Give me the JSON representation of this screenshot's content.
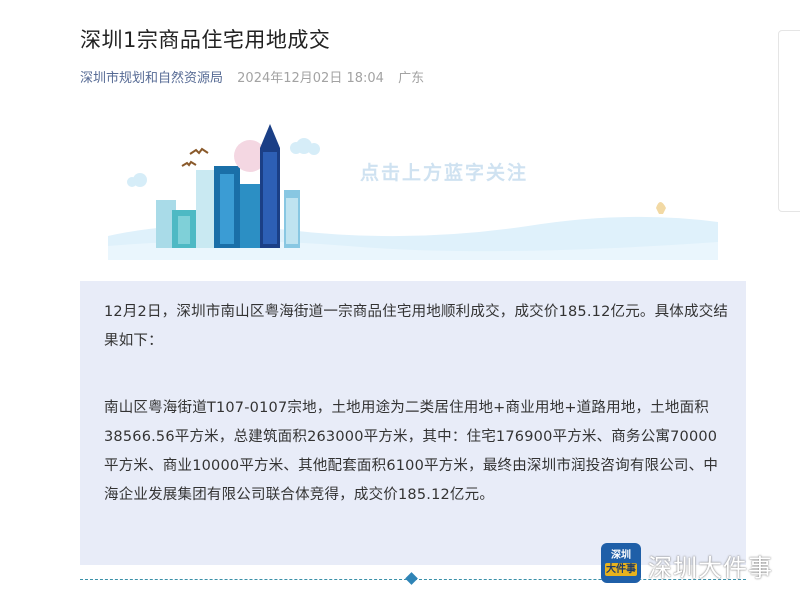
{
  "article": {
    "title": "深圳1宗商品住宅用地成交",
    "author": "深圳市规划和自然资源局",
    "date": "2024年12月02日 18:04",
    "region": "广东",
    "banner_text": "点击上方蓝字关注",
    "paragraphs": [
      "12月2日，深圳市南山区粤海街道一宗商品住宅用地顺利成交，成交价185.12亿元。具体成交结果如下：",
      "南山区粤海街道T107-0107宗地，土地用途为二类居住用地+商业用地+道路用地，土地面积38566.56平方米，总建筑面积263000平方米，其中：住宅176900平方米、商务公寓70000平方米、商业10000平方米、其他配套面积6100平方米，最终由深圳市润投咨询有限公司、中海企业发展集团有限公司联合体竞得，成交价185.12亿元。"
    ]
  },
  "watermark": {
    "logo_line1": "深圳",
    "logo_line2": "大件事",
    "text": "深圳大件事"
  },
  "colors": {
    "author_link": "#576b95",
    "quote_bg": "#e8ecf8",
    "divider": "#3a90a8"
  }
}
